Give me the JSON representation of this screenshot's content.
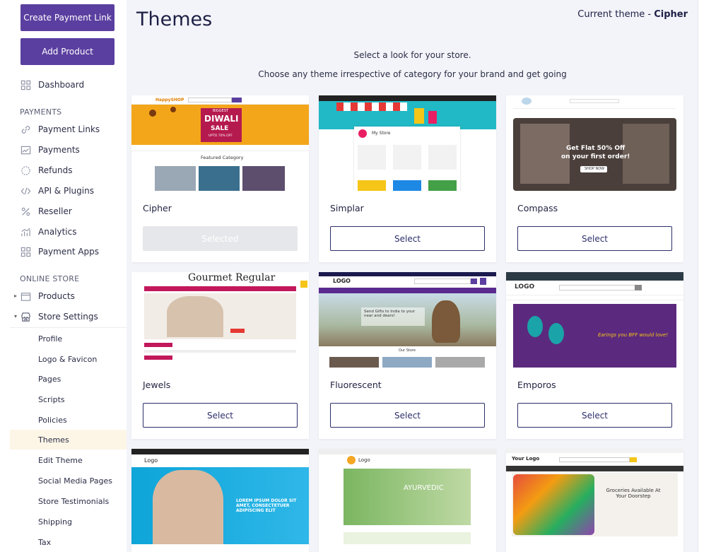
{
  "sidebar": {
    "create_payment_link": "Create Payment Link",
    "add_product": "Add Product",
    "dashboard": "Dashboard",
    "payments_section": "PAYMENTS",
    "payment_items": [
      "Payment Links",
      "Payments",
      "Refunds",
      "API & Plugins",
      "Reseller",
      "Analytics",
      "Payment Apps"
    ],
    "online_store_section": "ONLINE STORE",
    "products": "Products",
    "store_settings": "Store Settings",
    "store_sub_items": [
      "Profile",
      "Logo & Favicon",
      "Pages",
      "Scripts",
      "Policies",
      "Themes",
      "Edit Theme",
      "Social Media Pages",
      "Store Testimonials",
      "Shipping",
      "Tax"
    ],
    "active_sub_item": "Themes"
  },
  "header": {
    "title": "Themes",
    "current_theme_prefix": "Current theme - ",
    "current_theme_name": "Cipher",
    "subtitle1": "Select a look for your store.",
    "subtitle2": "Choose any theme irrespective of category for your brand and get going"
  },
  "themes": [
    {
      "name": "Cipher",
      "button": "Selected",
      "selected": true
    },
    {
      "name": "Simplar",
      "button": "Select",
      "selected": false
    },
    {
      "name": "Compass",
      "button": "Select",
      "selected": false
    },
    {
      "name": "Jewels",
      "button": "Select",
      "selected": false
    },
    {
      "name": "Fluorescent",
      "button": "Select",
      "selected": false
    },
    {
      "name": "Emporos",
      "button": "Select",
      "selected": false
    }
  ],
  "thumb_text": {
    "cipher_brand": "HappySHOP",
    "cipher_banner_top": "BIGGEST",
    "cipher_banner_main": "DIWALI",
    "cipher_banner_sale": "SALE",
    "cipher_banner_off": "UPTO 70% OFF",
    "cipher_featured": "Featured Category",
    "simplar_store": "My Store",
    "compass_banner": "Get Flat 50% Off",
    "compass_banner2": "on your first order!",
    "compass_btn": "SHOP NOW",
    "jewels_title": "Gourmet Regular",
    "fluor_logo": "LOGO",
    "fluor_banner": "Send Gifts to India to your near and dears!",
    "fluor_store": "Our Store",
    "emporos_logo": "LOGO",
    "emporos_banner": "Earings you BFF would love!",
    "r3a_logo": "Logo",
    "r3a_banner": "LOREM IPSUM DOLOR SIT AMET, CONSECTETUER ADIPISCING ELIT",
    "r3b_logo": "Logo",
    "r3b_banner": "AYURVEDIC",
    "r3c_logo": "Your Logo",
    "r3c_banner": "Groceries Available At Your Doorstep"
  },
  "colors": {
    "brand_purple": "#5b3fa0",
    "navy": "#2b2f6a",
    "active_bg": "#fdf6e7"
  }
}
